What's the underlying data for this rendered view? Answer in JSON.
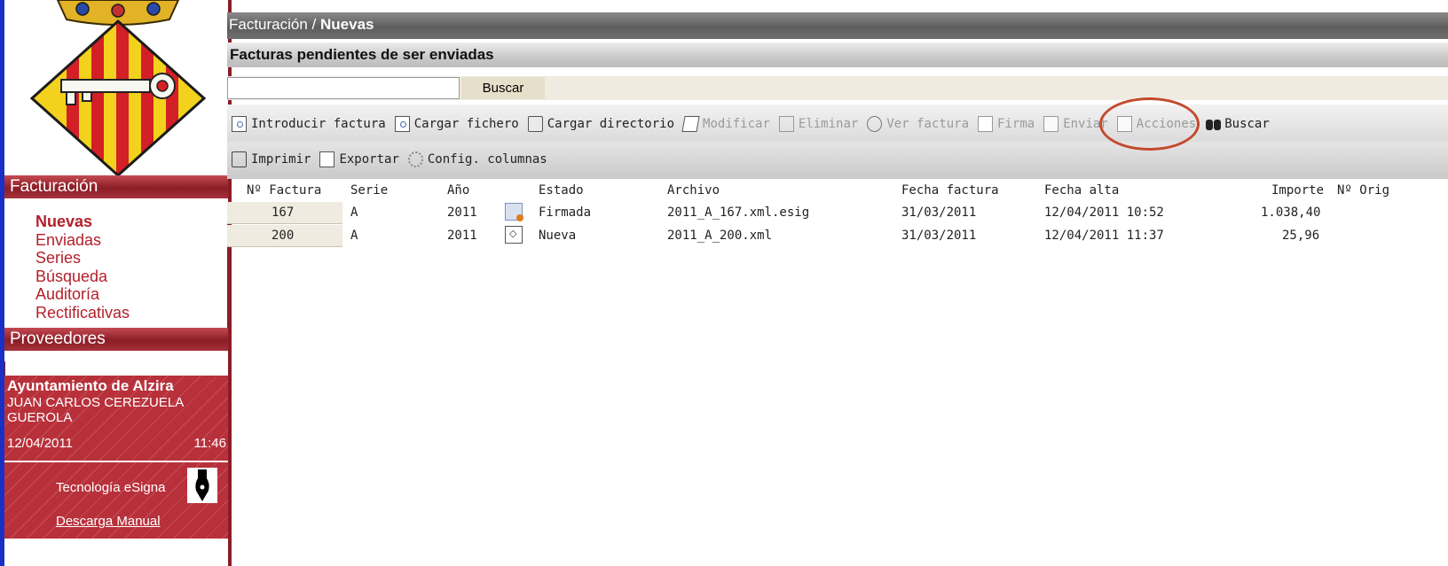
{
  "breadcrumb": {
    "section": "Facturación /",
    "current": "Nuevas"
  },
  "page_title": "Facturas pendientes de ser enviadas",
  "search": {
    "placeholder": "",
    "value": "",
    "button_label": "Buscar"
  },
  "toolbar": {
    "row1": [
      {
        "label": "Introducir factura",
        "icon": "new-invoice-icon",
        "enabled": true
      },
      {
        "label": "Cargar fichero",
        "icon": "load-file-icon",
        "enabled": true
      },
      {
        "label": "Cargar directorio",
        "icon": "load-directory-icon",
        "enabled": true
      },
      {
        "label": "Modificar",
        "icon": "edit-icon",
        "enabled": false
      },
      {
        "label": "Eliminar",
        "icon": "trash-icon",
        "enabled": false
      },
      {
        "label": "Ver factura",
        "icon": "view-invoice-icon",
        "enabled": false
      },
      {
        "label": "Firma",
        "icon": "sign-icon",
        "enabled": false
      },
      {
        "label": "Enviar",
        "icon": "send-icon",
        "enabled": false
      },
      {
        "label": "Acciones",
        "icon": "actions-icon",
        "enabled": false
      },
      {
        "label": "Buscar",
        "icon": "binoculars-icon",
        "enabled": true
      }
    ],
    "row2": [
      {
        "label": "Imprimir",
        "icon": "print-icon",
        "enabled": true
      },
      {
        "label": "Exportar",
        "icon": "export-icon",
        "enabled": true
      },
      {
        "label": "Config. columnas",
        "icon": "config-columns-icon",
        "enabled": true
      }
    ]
  },
  "table": {
    "headers": [
      "Nº Factura",
      "Serie",
      "Año",
      "Estado",
      "Archivo",
      "Fecha factura",
      "Fecha alta",
      "Importe",
      "Nº Orig"
    ],
    "rows": [
      {
        "numero": "167",
        "serie": "A",
        "anio": "2011",
        "estado": "Firmada",
        "estado_icon": "signed-invoice-icon",
        "archivo": "2011_A_167.xml.esig",
        "fecha_factura": "31/03/2011",
        "fecha_alta": "12/04/2011 10:52",
        "importe": "1.038,40"
      },
      {
        "numero": "200",
        "serie": "A",
        "anio": "2011",
        "estado": "Nueva",
        "estado_icon": "new-xml-icon",
        "archivo": "2011_A_200.xml",
        "fecha_factura": "31/03/2011",
        "fecha_alta": "12/04/2011 11:37",
        "importe": "25,96"
      }
    ]
  },
  "sidebar": {
    "facturacion_header": "Facturación",
    "items": [
      {
        "label": "Nuevas",
        "active": true
      },
      {
        "label": "Enviadas",
        "active": false
      },
      {
        "label": "Series",
        "active": false
      },
      {
        "label": "Búsqueda",
        "active": false
      },
      {
        "label": "Auditoría",
        "active": false
      },
      {
        "label": "Rectificativas",
        "active": false
      }
    ],
    "proveedores_header": "Proveedores",
    "user": {
      "organization": "Ayuntamiento de Alzira",
      "name_line1": "JUAN CARLOS CEREZUELA",
      "name_line2": "GUEROLA",
      "date": "12/04/2011",
      "time": "11:46"
    },
    "tech_label": "Tecnología eSigna",
    "manual_link": "Descarga Manual"
  },
  "colors": {
    "accent_red": "#b2202b",
    "header_gray": "#5e5e5e",
    "row_highlight": "#efebe1",
    "annotation_ring": "#c34a2c",
    "left_border_blue": "#1a2fc4"
  }
}
